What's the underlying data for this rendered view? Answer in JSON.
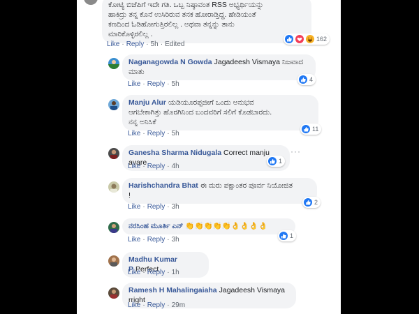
{
  "colors": {
    "link": "#385898",
    "meta": "#606770",
    "bubble": "#f2f3f5",
    "like_blue": "#2078f4"
  },
  "top_comment": {
    "lines": [
      "ಕೋಟ್ಯಿ ಬಿಜೆಪಿಗೆ ಇದೇ ಗತಿ. ಒಬ್ಬ ನಿಷ್ಠಾವಂತ RSS ಅಭ್ಯರ್ಥಿಯನ್ನು",
      "ಹಾಕಿದ್ರು ತನ್ನ ಕೊನೆ ಉಸಿರಿರುವ ತನಕ ಹೋರಾಡ್ತಿದ್ದ. ಹೇಡಿಯಂತೆ",
      "ಕಣದಿಂದ ಓಡಿಹೋಗುತ್ತಿರಲಿಲ್ಲ . ಅಥವಾ ತನ್ನನ್ನು ತಾನು",
      "ಮಾರಿಕೊಳ್ಳಿರಲಿಲ್ಲ ."
    ],
    "like": "Like",
    "reply": "Reply",
    "time": "5h",
    "edited": "Edited",
    "reactions": {
      "count": "162",
      "icons": [
        "like-icon",
        "love-icon",
        "haha-icon"
      ]
    }
  },
  "replies": [
    {
      "author": "Naganagowda N Gowda",
      "text_line1": "Jagadeesh Vismaya ನಿಜವಾದ",
      "text_line2": "ಮಾತು",
      "like": "Like",
      "reply": "Reply",
      "time": "5h",
      "reaction_count": "4"
    },
    {
      "author": "Manju Alur",
      "text_line1": "ಯಡಿಯೂರಪ್ಪಜೀಗೆ ಒಂದು ಅನುಭವ",
      "text_line2": "ಆಗಬೇಕಾಗಿತ್ತು ಹೊರಗಿನಿಂದ ಬಂದವರಿಗೆ ಸಲಿಗೆ ಕೊಡಬಾರದು.",
      "text_line3": "ನನ್ನ ಅನಿಸಿಕೆ",
      "like": "Like",
      "reply": "Reply",
      "time": "5h",
      "reaction_count": "11"
    },
    {
      "author": "Ganesha Sharma Nidugala",
      "text_line1": "Correct manju avare",
      "like": "Like",
      "reply": "Reply",
      "time": "4h",
      "reaction_count": "1"
    },
    {
      "author": "Harishchandra Bhat",
      "text_line1": "ಈ ಮರು ಪಕ್ಷಾಂತರ ಪೂರ್ವ ನಿಯೋಜಿತ",
      "text_line2": "!",
      "like": "Like",
      "reply": "Reply",
      "time": "3h",
      "reaction_count": "2"
    },
    {
      "author": "ನರಸಿಂಹ ಮೂರ್ತಿ ಎನ್",
      "text_line1": "👏👏👏👏👏👌👌👌👌",
      "like": "Like",
      "reply": "Reply",
      "time": "3h",
      "reaction_count": "1"
    },
    {
      "author": "Madhu Kumar P",
      "text_line1": "Perfect",
      "like": "Like",
      "reply": "Reply",
      "time": "1h"
    },
    {
      "author": "Ramesh H Mahalingaiaha",
      "text_line1": "Jagadeesh Vismaya rright",
      "like": "Like",
      "reply": "Reply",
      "time": "29m"
    }
  ],
  "more_label": "···"
}
